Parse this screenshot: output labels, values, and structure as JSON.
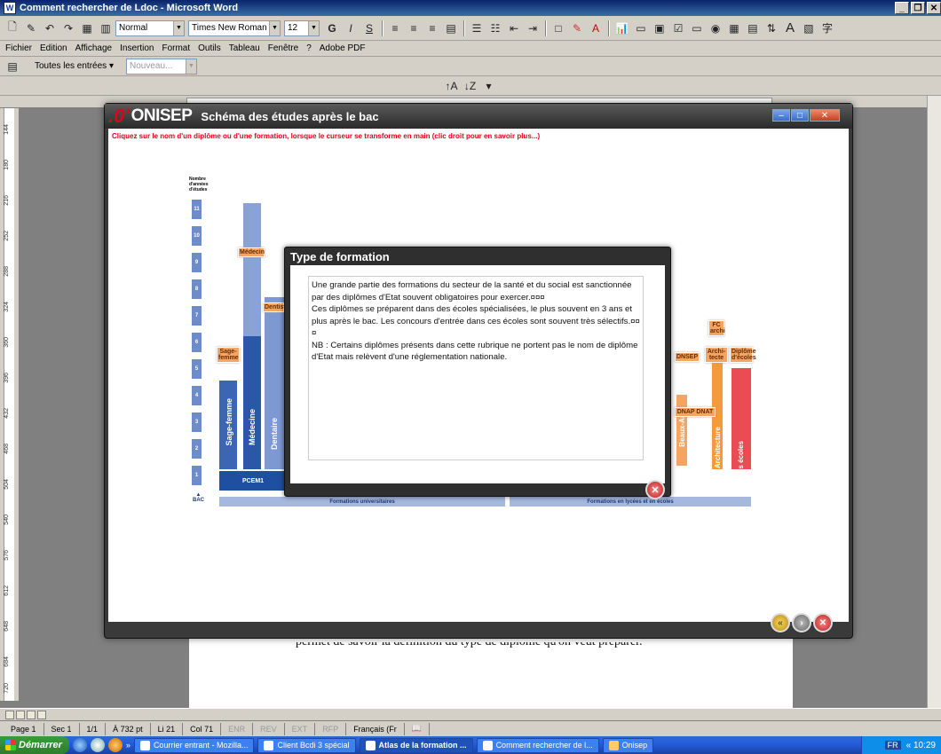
{
  "word": {
    "title": "Comment rechercher de Ldoc - Microsoft Word",
    "style": "Normal",
    "font": "Times New Roman",
    "size": "12",
    "menu": [
      "Fichier",
      "Edition",
      "Affichage",
      "Insertion",
      "Format",
      "Outils",
      "Tableau",
      "Fenêtre",
      "?",
      "Adobe PDF"
    ],
    "toolbar2_entries": "Toutes les entrées",
    "toolbar2_new": "Nouveau...",
    "ruler_numbers": [
      "144",
      "180",
      "216",
      "252",
      "288",
      "324",
      "360",
      "396",
      "432",
      "468",
      "504",
      "540",
      "576",
      "612",
      "648",
      "684",
      "720"
    ],
    "doc_line": "permet de savoir la définition du type de diplôme qu'on veut préparer."
  },
  "status": {
    "page": "Page 1",
    "sec": "Sec 1",
    "pages": "1/1",
    "pos": "À 732 pt",
    "line": "Li 21",
    "col": "Col 71",
    "enr": "ENR",
    "rev": "REV",
    "ext": "EXT",
    "rfp": "RFP",
    "lang": "Français (Fr"
  },
  "taskbar": {
    "start": "Démarrer",
    "tasks": [
      "Courrier entrant - Mozilla...",
      "Client Bcdi 3 spécial",
      "Atlas de la formation ...",
      "Comment rechercher de l...",
      "Onisep"
    ],
    "lang": "FR",
    "clock": "10:29"
  },
  "onisep": {
    "logo": "ONISEP",
    "heading": "Schéma des études après le bac",
    "instruction": "Cliquez sur le nom d'un diplôme ou d'une formation, lorsque le curseur se transforme en main (clic droit pour en savoir plus...)",
    "ylabel": "Nombre d'années d'études",
    "years": [
      "11",
      "10",
      "9",
      "8",
      "7",
      "6",
      "5",
      "4",
      "3",
      "2",
      "1"
    ],
    "bac": "BAC",
    "pcem": "PCEM1",
    "band_univ": "Formations universitaires",
    "band_ecoles": "Formations en lycées et en écoles",
    "columns": {
      "sage_femme": "Sage-femme",
      "medecine": "Médecine",
      "dentaire": "Dentaire",
      "beaux_arts": "Beaux-Arts",
      "architecture": "Architecture",
      "autres_ecoles": "Autres écoles"
    },
    "tags": {
      "medecin": "Médecin",
      "dentiste": "Dentiste",
      "sage_femme": "Sage-femme",
      "dnsep": "DNSEP",
      "architecte": "Archi-tecte",
      "diplome_ecoles": "Diplôme d'écoles",
      "fc_archi": "FC archi",
      "dnap_dnat": "DNAP DNAT"
    }
  },
  "popup": {
    "title": "Type de formation",
    "p1": "Une grande partie des formations du secteur de la santé et du social est sanctionnée par des diplômes d'Etat souvent obligatoires pour exercer.¤¤¤",
    "p2": "Ces diplômes se préparent dans des écoles spécialisées, le plus souvent en 3 ans et plus après le bac. Les concours d'entrée dans ces écoles sont souvent très sélectifs.¤¤¤",
    "p3": "NB : Certains diplômes présents dans cette rubrique ne portent pas le nom de diplôme d'Etat mais relèvent d'une réglementation nationale."
  }
}
